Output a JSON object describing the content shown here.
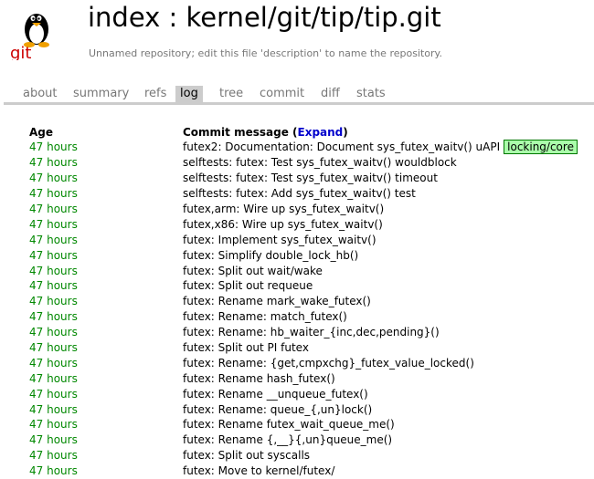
{
  "header": {
    "title": "index : kernel/git/tip/tip.git",
    "description": "Unnamed repository; edit this file 'description' to name the repository.",
    "logo_text": "git"
  },
  "tabs": [
    {
      "label": "about"
    },
    {
      "label": "summary"
    },
    {
      "label": "refs"
    },
    {
      "label": "log"
    },
    {
      "label": "tree"
    },
    {
      "label": "commit"
    },
    {
      "label": "diff"
    },
    {
      "label": "stats"
    }
  ],
  "active_tab": "log",
  "table": {
    "age_header": "Age",
    "message_header": "Commit message (",
    "expand_label": "Expand",
    "message_header_close": ")",
    "rows": [
      {
        "age": "47 hours",
        "message": "futex2: Documentation: Document sys_futex_waitv() uAPI",
        "badge": "locking/core"
      },
      {
        "age": "47 hours",
        "message": "selftests: futex: Test sys_futex_waitv() wouldblock"
      },
      {
        "age": "47 hours",
        "message": "selftests: futex: Test sys_futex_waitv() timeout"
      },
      {
        "age": "47 hours",
        "message": "selftests: futex: Add sys_futex_waitv() test"
      },
      {
        "age": "47 hours",
        "message": "futex,arm: Wire up sys_futex_waitv()"
      },
      {
        "age": "47 hours",
        "message": "futex,x86: Wire up sys_futex_waitv()"
      },
      {
        "age": "47 hours",
        "message": "futex: Implement sys_futex_waitv()"
      },
      {
        "age": "47 hours",
        "message": "futex: Simplify double_lock_hb()"
      },
      {
        "age": "47 hours",
        "message": "futex: Split out wait/wake"
      },
      {
        "age": "47 hours",
        "message": "futex: Split out requeue"
      },
      {
        "age": "47 hours",
        "message": "futex: Rename mark_wake_futex()"
      },
      {
        "age": "47 hours",
        "message": "futex: Rename: match_futex()"
      },
      {
        "age": "47 hours",
        "message": "futex: Rename: hb_waiter_{inc,dec,pending}()"
      },
      {
        "age": "47 hours",
        "message": "futex: Split out PI futex"
      },
      {
        "age": "47 hours",
        "message": "futex: Rename: {get,cmpxchg}_futex_value_locked()"
      },
      {
        "age": "47 hours",
        "message": "futex: Rename hash_futex()"
      },
      {
        "age": "47 hours",
        "message": "futex: Rename __unqueue_futex()"
      },
      {
        "age": "47 hours",
        "message": "futex: Rename: queue_{,un}lock()"
      },
      {
        "age": "47 hours",
        "message": "futex: Rename futex_wait_queue_me()"
      },
      {
        "age": "47 hours",
        "message": "futex: Rename {,__}{,un}queue_me()"
      },
      {
        "age": "47 hours",
        "message": "futex: Split out syscalls"
      },
      {
        "age": "47 hours",
        "message": "futex: Move to kernel/futex/"
      }
    ]
  }
}
